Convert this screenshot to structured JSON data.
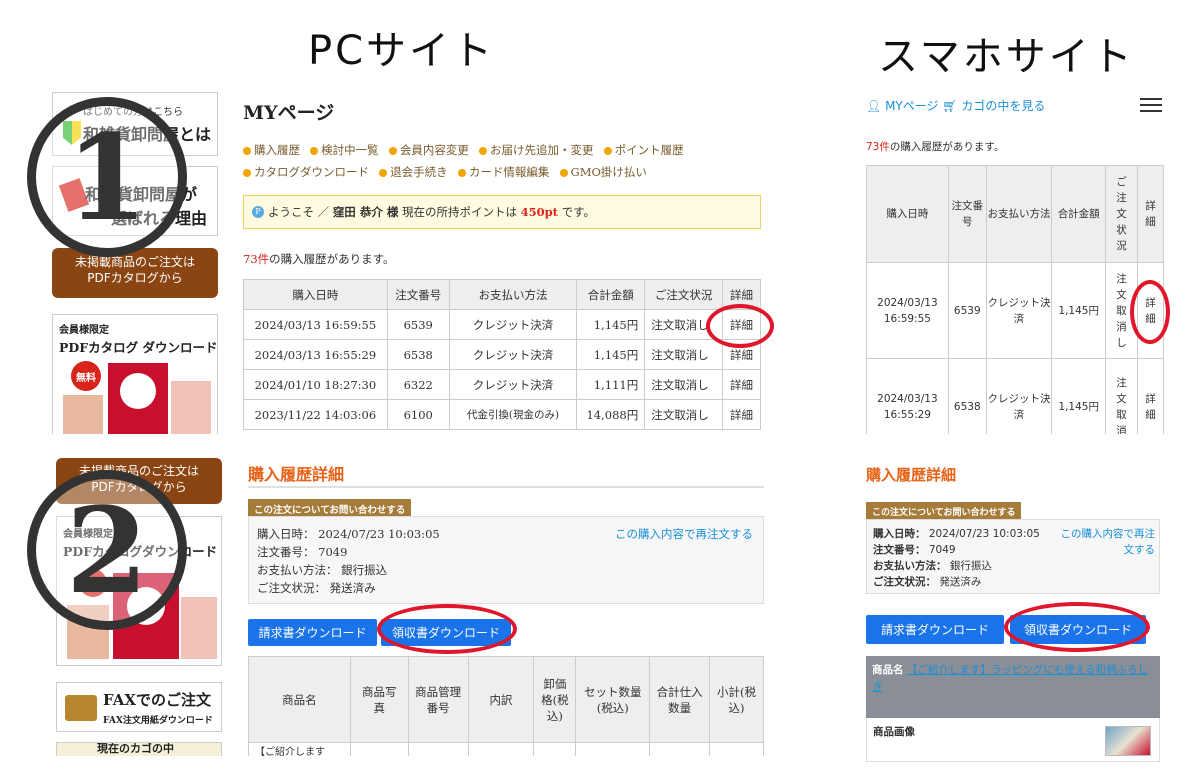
{
  "headers": {
    "pc": "PCサイト",
    "sp": "スマホサイト"
  },
  "sidebar": {
    "beginner_small": "はじめての方はこちら",
    "beginner_big": "和雑貨卸問屋とは",
    "reason_line1": "和雑貨卸問屋が",
    "reason_line2": "選ばれる理由",
    "catalog_tab1_line1": "未掲載商品のご注文は",
    "catalog_tab1_line2": "PDFカタログから",
    "catalog_small": "会員様限定",
    "catalog_big": "PDFカタログ ダウンロード",
    "free_badge": "無料",
    "fax_big": "FAXでのご注文",
    "fax_small": "FAX注文用紙ダウンロード",
    "catalog_tab2_line1": "未掲載商品のご注文は",
    "catalog_tab2_line2": "PDFカタログから",
    "catalog2_small": "会員様限定",
    "catalog2_big": "PDFカタログダウンロード",
    "bottom_cut": "現在のカゴの中"
  },
  "markers": {
    "one": "1",
    "two": "2"
  },
  "pc": {
    "title": "MYページ",
    "links_row1": [
      "購入履歴",
      "検討中一覧",
      "会員内容変更",
      "お届け先追加・変更",
      "ポイント履歴"
    ],
    "links_row2": [
      "カタログダウンロード",
      "退会手続き",
      "カード情報編集",
      "GMO掛け払い"
    ],
    "welcome_prefix": "ようこそ ／",
    "user_name": "窪田 恭介 様",
    "welcome_mid": "現在の所持ポイントは",
    "points": "450pt",
    "welcome_suffix": "です。",
    "history_count": "73件",
    "history_text": "の購入履歴があります。",
    "table_headers": [
      "購入日時",
      "注文番号",
      "お支払い方法",
      "合計金額",
      "ご注文状況",
      "詳細"
    ],
    "rows": [
      [
        "2024/03/13 16:59:55",
        "6539",
        "クレジット決済",
        "1,145円",
        "注文取消し",
        "詳細"
      ],
      [
        "2024/03/13 16:55:29",
        "6538",
        "クレジット決済",
        "1,145円",
        "注文取消し",
        "詳細"
      ],
      [
        "2024/01/10 18:27:30",
        "6322",
        "クレジット決済",
        "1,111円",
        "注文取消し",
        "詳細"
      ],
      [
        "2023/11/22 14:03:06",
        "6100",
        "代金引換(現金のみ)",
        "14,088円",
        "注文取消し",
        "詳細"
      ]
    ],
    "detail": {
      "title": "購入履歴詳細",
      "inquiry": "この注文についてお問い合わせする",
      "date_label": "購入日時：",
      "date": "2024/07/23 10:03:05",
      "reorder": "この購入内容で再注文する",
      "order_label": "注文番号：",
      "order_no": "7049",
      "pay_label": "お支払い方法：",
      "pay": "銀行振込",
      "status_label": "ご注文状況：",
      "status": "発送済み",
      "invoice_btn": "請求書ダウンロード",
      "receipt_btn": "領収書ダウンロード",
      "item_headers": [
        "商品名",
        "商品写真",
        "商品管理番号",
        "内訳",
        "卸価格(税込)",
        "セット数量(税込)",
        "合計仕入数量",
        "小計(税込)"
      ],
      "item_cut": "【ご紹介します"
    }
  },
  "sp": {
    "mypage": "MYページ",
    "cart": "カゴの中を見る",
    "history_count": "73件",
    "history_text": "の購入履歴があります。",
    "table_headers": [
      "購入日時",
      "注文番号",
      "お支払い方法",
      "合計金額",
      "ご注文状況",
      "詳細"
    ],
    "rows": [
      [
        "2024/03/13 16:59:55",
        "6539",
        "クレジット決済",
        "1,145円",
        "注文取消し",
        "詳細"
      ],
      [
        "2024/03/13 16:55:29",
        "6538",
        "クレジット決済",
        "1,145円",
        "注文取消",
        "詳細"
      ]
    ],
    "detail": {
      "title": "購入履歴詳細",
      "inquiry": "この注文についてお問い合わせする",
      "date_label": "購入日時：",
      "date": "2024/07/23 10:03:05",
      "reorder": "この購入内容で再注文する",
      "order_label": "注文番号：",
      "order_no": "7049",
      "pay_label": "お支払い方法：",
      "pay": "銀行振込",
      "status_label": "ご注文状況：",
      "status": "発送済み",
      "invoice_btn": "請求書ダウンロード",
      "receipt_btn": "領収書ダウンロード",
      "item_label": "商品名",
      "item_link": "【ご紹介します】ラッピングにも使える和柄ふろしき",
      "image_label": "商品画像"
    }
  },
  "colors": {
    "accent": "#1a73e8",
    "highlight": "#e0162b",
    "title": "#e8631a",
    "tag": "#a67c3a"
  }
}
